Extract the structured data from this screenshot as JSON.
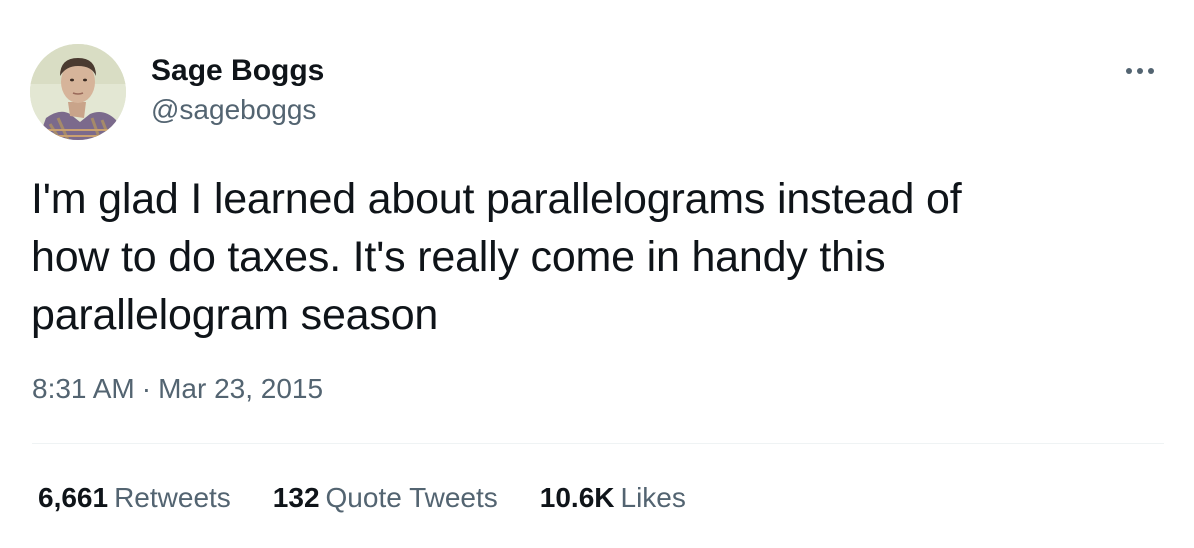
{
  "author": {
    "name": "Sage Boggs",
    "handle": "@sageboggs",
    "avatar_icon": "profile-photo"
  },
  "more_icon": "ellipsis-icon",
  "tweet": {
    "text_lines": [
      "I'm glad I learned about parallelograms instead of",
      "how to do taxes. It's really come in handy this",
      "parallelogram season"
    ],
    "time": "8:31 AM",
    "separator": "·",
    "date": "Mar 23, 2015"
  },
  "stats": {
    "retweets": {
      "count": "6,661",
      "label": "Retweets"
    },
    "quote_tweets": {
      "count": "132",
      "label": "Quote Tweets"
    },
    "likes": {
      "count": "10.6K",
      "label": "Likes"
    }
  },
  "colors": {
    "text_primary": "#0f1419",
    "text_secondary": "#536471",
    "divider": "#eff3f4"
  }
}
